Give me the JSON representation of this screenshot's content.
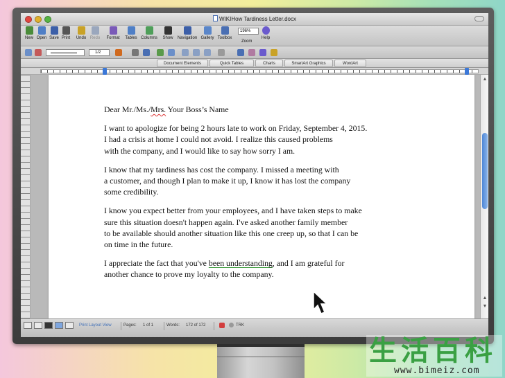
{
  "window": {
    "title": "WIKIHow Tardiness Letter.docx"
  },
  "toolbar": {
    "buttons": [
      {
        "label": "New",
        "icon": "new-document-icon",
        "color": "#4a8c3a"
      },
      {
        "label": "Open",
        "icon": "open-folder-icon",
        "color": "#4f7fc6"
      },
      {
        "label": "Save",
        "icon": "save-icon",
        "color": "#3c5fa8"
      },
      {
        "label": "Print",
        "icon": "print-icon",
        "color": "#555555"
      },
      {
        "label": "Undo",
        "icon": "undo-icon",
        "color": "#c9a227"
      },
      {
        "label": "Redo",
        "icon": "redo-icon",
        "color": "#9aa7bd"
      },
      {
        "label": "Format",
        "icon": "paintbrush-icon",
        "color": "#7a5ab8"
      },
      {
        "label": "Tables",
        "icon": "table-icon",
        "color": "#4f7fc6"
      },
      {
        "label": "Columns",
        "icon": "columns-icon",
        "color": "#4f9f5a"
      },
      {
        "label": "Show",
        "icon": "pilcrow-icon",
        "color": "#333333"
      },
      {
        "label": "Navigation",
        "icon": "navigation-pane-icon",
        "color": "#3c5fa8"
      },
      {
        "label": "Gallery",
        "icon": "gallery-icon",
        "color": "#5a86c9"
      },
      {
        "label": "Toolbox",
        "icon": "toolbox-icon",
        "color": "#4a6fb3"
      },
      {
        "label": "Help",
        "icon": "help-icon",
        "color": "#6a5acd"
      }
    ],
    "zoom_value": "196%",
    "zoom_label": "Zoom"
  },
  "format_bar": {
    "line_weight": "1/2"
  },
  "ribbon": {
    "tabs": [
      "Document Elements",
      "Quick Tables",
      "Charts",
      "SmartArt Graphics",
      "WordArt"
    ]
  },
  "document": {
    "salutation_prefix": "Dear Mr./Ms./",
    "salutation_misspelled": "Mrs.",
    "salutation_suffix": " Your Boss’s Name",
    "paragraphs": [
      {
        "lines": [
          "I want to apologize for being 2 hours late to work on Friday, September 4, 2015.",
          "I had a crisis at home I could not avoid. I realize this caused problems",
          "with the company, and I would like to say how sorry I am."
        ]
      },
      {
        "lines": [
          "I know that my tardiness has cost the company. I missed a meeting with",
          "a customer, and though I plan to make it up, I know it has lost the company",
          "some credibility."
        ]
      },
      {
        "lines": [
          "I know you expect better from your employees, and I have taken steps to make",
          "sure this situation doesn't happen again. I've asked another family member",
          "to be available should another situation like this one creep up, so that I can be",
          "on time in the future."
        ]
      }
    ],
    "closing_line1_prefix": "I appreciate the fact that you've ",
    "closing_line1_flagged": "been understanding",
    "closing_line1_suffix": ", and I am grateful for",
    "closing_line2": "another chance to prove my loyalty to the company."
  },
  "status_bar": {
    "view": "Print Layout View",
    "pages_label": "Pages:",
    "pages_value": "1 of 1",
    "words_label": "Words:",
    "words_value": "172 of 172",
    "trk": "TRK"
  },
  "watermark": {
    "chars": "生活百科",
    "url": "www.bimeiz.com"
  },
  "colors": {
    "accent": "#3b78d8",
    "spell_error": "#dd3333",
    "grammar": "#3a9a3a"
  }
}
